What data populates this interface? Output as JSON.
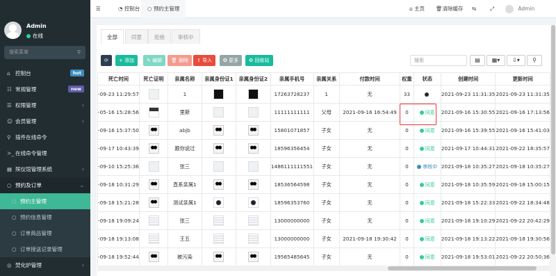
{
  "sidebar": {
    "user": {
      "name": "Admin",
      "status": "在线"
    },
    "search_placeholder": "搜索菜单",
    "items": [
      {
        "icon": "⌂",
        "label": "控制台",
        "badge": "hot",
        "badge_color": "#3c8dbc"
      },
      {
        "icon": "☷",
        "label": "常规管理",
        "badge": "new",
        "badge_color": "#605ca8"
      },
      {
        "icon": "☰",
        "label": "权限管理",
        "arrow": "‹"
      },
      {
        "icon": "☺",
        "label": "会员管理",
        "arrow": "‹"
      },
      {
        "icon": "⚲",
        "label": "插件在线命令"
      },
      {
        "icon": ">_",
        "label": "在线命令管理"
      },
      {
        "icon": "▦",
        "label": "殡仪馆管理系统",
        "arrow": "‹"
      },
      {
        "icon": "○",
        "label": "预约及订单",
        "arrow": "⌄",
        "open": true
      },
      {
        "icon": "○",
        "label": "预约主管理",
        "sub": true,
        "active": true
      },
      {
        "icon": "○",
        "label": "预约信息管理",
        "sub": true
      },
      {
        "icon": "○",
        "label": "订单商品管理",
        "sub": true
      },
      {
        "icon": "○",
        "label": "订单接送记录管理",
        "sub": true
      },
      {
        "icon": "◎",
        "label": "焚化炉管理",
        "arrow": "‹"
      }
    ]
  },
  "topbar": {
    "menu_icon": "☰",
    "tabs": [
      {
        "icon": "◔",
        "label": "控制台"
      },
      {
        "icon": "○",
        "label": "预约主管理"
      }
    ],
    "home": "主页",
    "clear_cache": "清除缓存",
    "user": "Admin"
  },
  "panel": {
    "tabs": [
      "全部",
      "同意",
      "拒绝",
      "审核中"
    ],
    "buttons": [
      {
        "label": "⟳",
        "color": "#2c3e50"
      },
      {
        "label": "+ 添加",
        "color": "#18bc9c"
      },
      {
        "label": "✎ 编辑",
        "color": "#7fd7c4"
      },
      {
        "label": "🗑 删除",
        "color": "#f59a8f"
      },
      {
        "label": "⇪ 导入",
        "color": "#e74c3c"
      },
      {
        "label": "✪ 更多",
        "color": "#95a5a6"
      },
      {
        "label": "♻ 回收站",
        "color": "#18bc9c"
      }
    ],
    "search_placeholder": "搜索"
  },
  "table": {
    "headers": [
      "死亡时间",
      "死亡证明",
      "亲属名称",
      "亲属身份证1",
      "亲属身份证2",
      "亲属手机号",
      "亲属关系",
      "付款时间",
      "权重",
      "状态",
      "创建时间",
      "更新时间"
    ],
    "rows": [
      {
        "death": "-09-23 11:29:57",
        "cert": "light",
        "name": "1",
        "id1": "black",
        "id2": "black",
        "phone": "17263728237",
        "rel": "1",
        "paid": "无",
        "w": "33",
        "status": "",
        "sclass": "dark",
        "created": "2021-09-23 11:31:35",
        "updated": "2021-09-23 11:31:35"
      },
      {
        "death": "-05-16 15:28:56",
        "cert": "dark",
        "name": "里斯",
        "id1": "light",
        "id2": "light",
        "phone": "11111111111",
        "rel": "父母",
        "paid": "2021-09-16 16:54:49",
        "w": "0",
        "status": "同意",
        "sclass": "green",
        "created": "2021-09-16 15:30:55",
        "updated": "2021-09-16 17:13:56"
      },
      {
        "death": "-09-16 15:37:50",
        "cert": "panda",
        "name": "abjb",
        "id1": "panda",
        "id2": "panda",
        "phone": "15801071857",
        "rel": "子女",
        "paid": "无",
        "w": "0",
        "status": "同意",
        "sclass": "green",
        "created": "2021-09-16 15:39:55",
        "updated": "2021-09-16 15:41:03"
      },
      {
        "death": "-09-17 10:43:39",
        "cert": "panda",
        "name": "跟你说过",
        "id1": "panda",
        "id2": "panda",
        "phone": "18596356454",
        "rel": "子女",
        "paid": "无",
        "w": "0",
        "status": "同意",
        "sclass": "green",
        "created": "2021-09-17 10:44:31",
        "updated": "2021-09-22 18:35:57"
      },
      {
        "death": "-09-10 15:25:36",
        "cert": "light",
        "name": "张三",
        "id1": "light",
        "id2": "light",
        "phone": "1486111111551",
        "rel": "子女",
        "paid": "无",
        "w": "0",
        "status": "审核中",
        "sclass": "blue",
        "created": "2021-09-18 10:35:27",
        "updated": "2021-09-18 10:35:27"
      },
      {
        "death": "-09-18 10:31:29",
        "cert": "panda",
        "name": "直系亲属1",
        "id1": "panda",
        "id2": "panda",
        "phone": "18536564598",
        "rel": "子女",
        "paid": "无",
        "w": "0",
        "status": "同意",
        "sclass": "green",
        "created": "2021-09-18 10:35:59",
        "updated": "2021-09-18 15:00:15"
      },
      {
        "death": "-09-18 15:21:28",
        "cert": "panda",
        "name": "测试亲属1",
        "id1": "c",
        "id2": "c",
        "phone": "18596353760",
        "rel": "子女",
        "paid": "无",
        "w": "0",
        "status": "同意",
        "sclass": "green",
        "created": "2021-09-18 15:22:33",
        "updated": "2021-09-22 18:34:48"
      },
      {
        "death": "-09-18 19:09:24",
        "cert": "doc",
        "name": "张三",
        "id1": "doc",
        "id2": "doc",
        "phone": "13000000000",
        "rel": "子女",
        "paid": "无",
        "w": "0",
        "status": "同意",
        "sclass": "green",
        "created": "2021-09-18 19:10:29",
        "updated": "2021-09-22 20:42:29"
      },
      {
        "death": "-09-18 19:13:08",
        "cert": "doc",
        "name": "王五",
        "id1": "doc",
        "id2": "doc",
        "phone": "13000000000",
        "rel": "子女",
        "paid": "2021-09-18 19:30:42",
        "w": "0",
        "status": "同意",
        "sclass": "green",
        "created": "2021-09-18 19:13:22",
        "updated": "2021-09-18 19:30:56"
      },
      {
        "death": "-09-18 19:52:44",
        "cert": "panda",
        "name": "被污染",
        "id1": "panda",
        "id2": "panda",
        "phone": "19565485645",
        "rel": "子女",
        "paid": "无",
        "w": "0",
        "status": "同意",
        "sclass": "green",
        "created": "2021-09-18 19:53:01",
        "updated": "2021-09-22 20:50:36"
      }
    ]
  },
  "colors": {
    "green": "#3c9",
    "blue": "#3c8dbc",
    "dark": "#222d32",
    "accent": "#3fb895"
  }
}
